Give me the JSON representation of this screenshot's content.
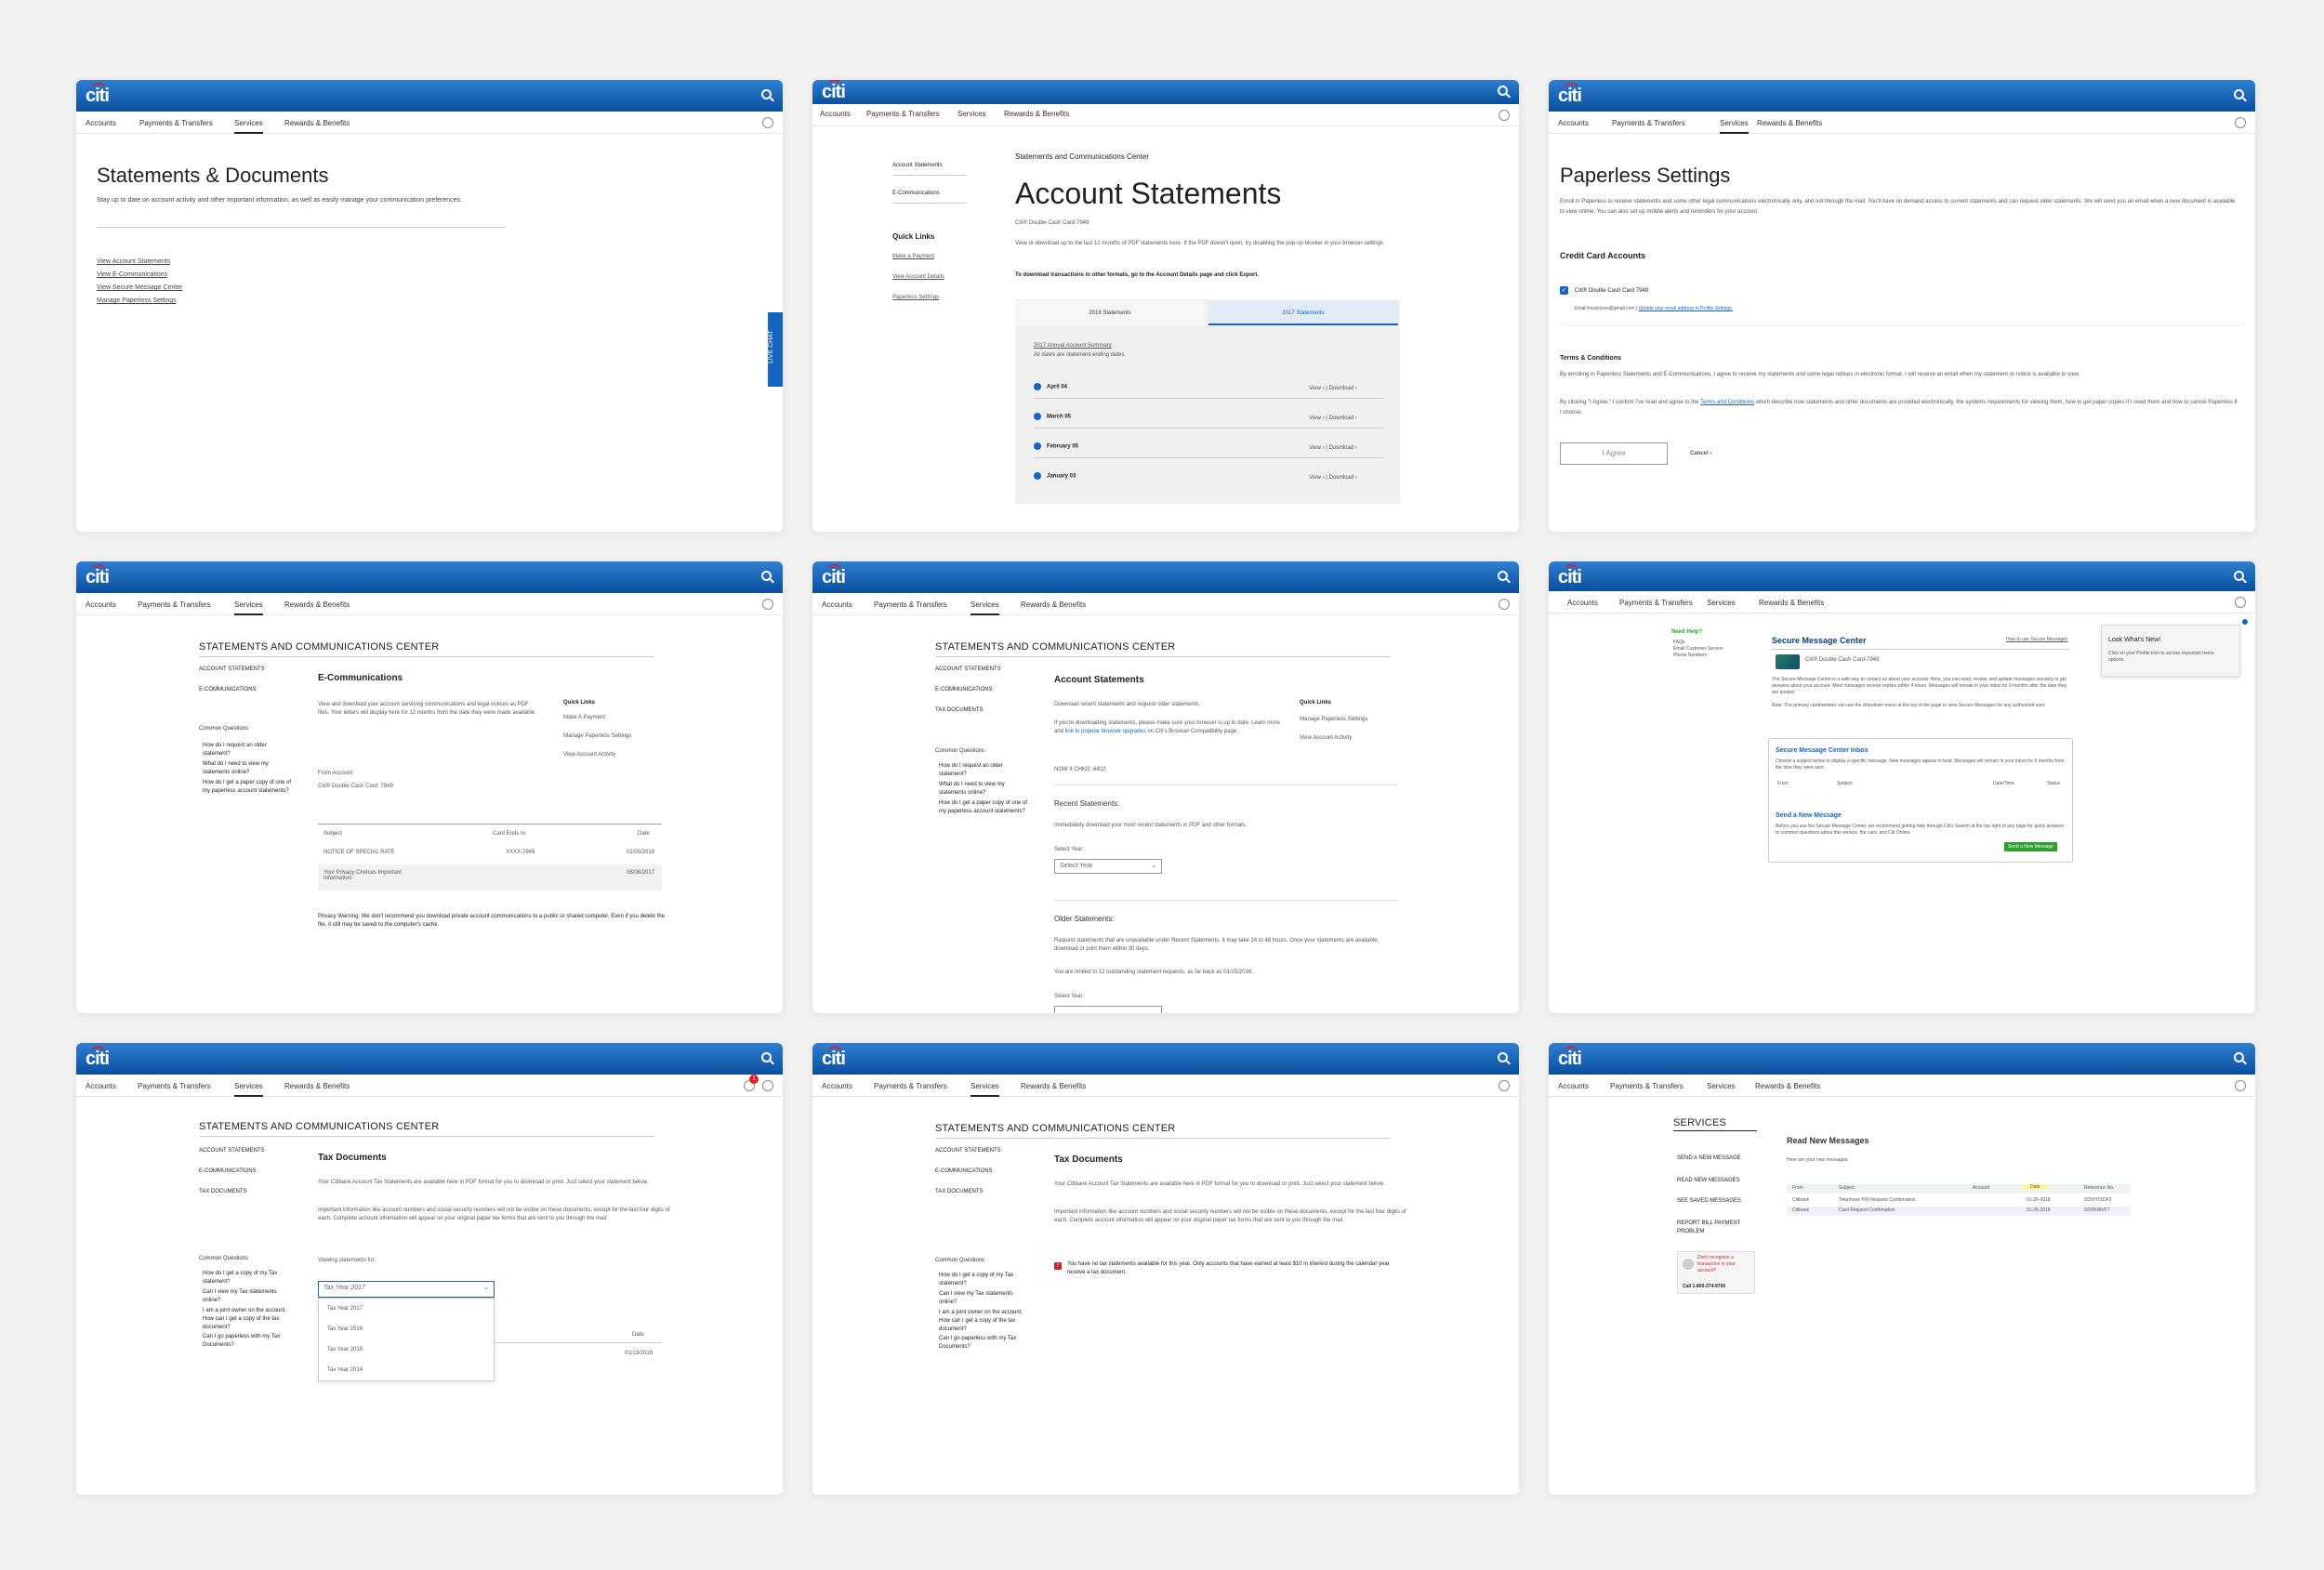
{
  "brand": {
    "logo": "citi"
  },
  "nav": {
    "accounts": "Accounts",
    "payments": "Payments & Transfers",
    "services": "Services",
    "rewards": "Rewards & Benefits"
  },
  "p1": {
    "title": "Statements & Documents",
    "subtitle": "Stay up to date on account activity and other important information, as well as easily manage your communication preferences.",
    "links": [
      "View Account Statements",
      "View E-Communications",
      "View Secure Message Center",
      "Manage Paperless Settings"
    ],
    "live_chat": "LIVE CHAT"
  },
  "p2": {
    "side": [
      "Account Statements",
      "E-Communications"
    ],
    "quick_title": "Quick Links",
    "quick": [
      "Make a Payment",
      "View Account Details",
      "Paperless Settings"
    ],
    "eyebrow": "Statements and Communications Center",
    "title": "Account Statements",
    "card": "Citi® Double Cash Card-7949",
    "desc": "View or download up to the last 12 months of PDF statements here. If the PDF doesn't open, try disabling the pop-up blocker in your browser settings.",
    "bold_note": "To download transactions in other formats, go to the Account Details page and click Export.",
    "tabs": [
      "2018 Statements",
      "2017 Statements"
    ],
    "summary_link": "2017 Annual Account Summary",
    "summary_note": "All dates are statement ending dates.",
    "rows": [
      "April 04",
      "March 05",
      "February 05",
      "January 03"
    ],
    "view": "View ›",
    "download": "Download ›"
  },
  "p3": {
    "title": "Paperless Settings",
    "desc": "Enroll in Paperless to receive statements and some other legal communications electronically only, and not through the mail. You'll have on demand access to current statements and can request older statements. We will send you an email when a new document is available to view online. You can also set up mobile alerts and reminders for your account.",
    "section": "Credit Card Accounts",
    "card": "Citi® Double Cash Card 7949",
    "email": "Email:hxxxxxxxx@gmail.com",
    "email_link": "Update your email address in Profile Settings.",
    "terms_title": "Terms & Conditions",
    "terms1": "By enrolling in Paperless Statements and E-Communications, I agree to receive my statements and some legal notices in electronic format. I will receive an email when my statement or notice is available to view.",
    "terms2a": "By clicking \"I Agree,\" I confirm I've read and agree to the",
    "terms_link": "Terms and Conditions",
    "terms2b": "which describe how statements and other documents are provided electronically, the systems requirements for viewing them, how to get paper copies if I need them and how to cancel Paperless if I choose.",
    "agree": "I Agree",
    "cancel": "Cancel ›"
  },
  "center": {
    "title": "STATEMENTS AND COMMUNICATIONS CENTER",
    "side": [
      "ACCOUNT STATEMENTS",
      "E-COMMUNICATIONS",
      "TAX DOCUMENTS"
    ],
    "cq": "Common Questions",
    "q_stmt": [
      "How do I request an older statement?",
      "What do I need to view my statements online?",
      "How do I get a paper copy of one of my paperless account statements?"
    ],
    "q_tax": [
      "How do I get a copy of my Tax statement?",
      "Can I view my Tax statements online?",
      "I am a joint owner on the account. How can I get a copy of the tax document?",
      "Can I go paperless with my Tax Documents?"
    ],
    "quick_title": "Quick Links"
  },
  "p4": {
    "heading": "E-Communications",
    "desc": "View and download your account servicing communications and legal notices as PDF files. Your letters will display here for 12 months from the date they were made available.",
    "quick": [
      "Make A Payment",
      "Manage Paperless Settings",
      "View Account Activity"
    ],
    "from_label": "From Account:",
    "from_value": "Citi® Double Cash Card: 7949",
    "cols": [
      "Subject",
      "Card Ends In",
      "Date"
    ],
    "row1": [
      "NOTICE OF SPECIAL RATE",
      "XXXX-7949",
      "01/05/2018"
    ],
    "row2": [
      "Your Privacy Choices Important Information",
      "",
      "08/08/2017"
    ],
    "privacy": "Privacy Warning: We don't recommend you download private account communications to a public or shared computer. Even if you delete the file, it still may be saved to the computer's cache."
  },
  "p5": {
    "heading": "Account Statements",
    "desc1": "Download recent statements and request older statements.",
    "desc2": "If you're downloading statements, please make sure your browser is up to date. Learn more and",
    "desc2_link": "link to popular browser upgrades",
    "desc2b": "on Citi's Browser Compatibility page.",
    "acct": "NOW II CHKG: 6422",
    "quick": [
      "Manage Paperless Settings",
      "View Account Activity"
    ],
    "recent": "Recent Statements:",
    "recent_desc": "Immediately download your most recent statements in PDF and other formats.",
    "select_label": "Select Year:",
    "select_ph": "Select Year",
    "older": "Older Statements:",
    "older_desc": "Request statements that are unavailable under Recent Statements. It may take 24 to 48 hours. Once your statements are available, download or print them within 30 days.",
    "limit": "You are limited to 12 outstanding statement requests, as far back as 01/25/2016.",
    "select_label2": "Select Year:"
  },
  "p6": {
    "need_help": "Need Help?",
    "help_links": [
      "FAQs",
      "Email Customer Service",
      "Phone Numbers"
    ],
    "title": "Secure Message Center",
    "howto": "How to use Secure Messages",
    "card": "Citi® Double Cash Card-7949",
    "desc": "The Secure Message Center is a safe way to contact us about your account. Here, you can send, review, and update messages securely to get answers about your account. Most messages receive replies within 4 hours. Messages will remain in your inbox for 6 months after the date they are posted.",
    "note": "Note: The primary cardmember can use the dropdown menu at the top of the page to view Secure Messages for any authorized user.",
    "inbox_title": "Secure Message Center Inbox",
    "inbox_desc": "Choose a subject below to display a specific message. New messages appear in bold. Messages will remain in your inbox for 6 months from the time they were sent.",
    "cols": [
      "From",
      "Subject",
      "Date/Time",
      "Status"
    ],
    "send_title": "Send a New Message",
    "send_desc": "Before you use the Secure Message Center, we recommend getting help through Citi's Search at the top right of any page for quick answers to common questions about this service, the card, and Citi Online.",
    "send_btn": "Send a New Message",
    "tip_title": "Look What's New!",
    "tip_desc": "Click on your Profile icon to access important menu options."
  },
  "p7": {
    "heading": "Tax Documents",
    "desc1": "Your Citibank Account Tax Statements are available here in PDF format for you to download or print. Just select your statement below.",
    "desc2": "Important information like account numbers and social security numbers will not be visible on these documents, except for the last four digits of each. Complete account information will appear on your original paper tax forms that are sent to you through the mail.",
    "viewing": "Viewing statements for:",
    "selected": "Tax Year 2017",
    "options": [
      "Tax Year 2017",
      "Tax Year 2016",
      "Tax Year 2015",
      "Tax Year 2014"
    ],
    "col_date": "Date",
    "row_date": "01/13/2018",
    "badge": "1"
  },
  "p8": {
    "heading": "Tax Documents",
    "desc1": "Your Citibank Account Tax Statements are available here in PDF format for you to download or print. Just select your statement below.",
    "desc2": "Important information like account numbers and social security numbers will not be visible on these documents, except for the last four digits of each. Complete account information will appear on your original paper tax forms that are sent to you through the mail.",
    "warning": "You have no tax statements available for this year. Only accounts that have earned at least $10 in interest during the calendar year receive a tax document."
  },
  "p9": {
    "title": "SERVICES",
    "side": [
      "SEND A NEW MESSAGE",
      "READ NEW MESSAGES",
      "SEE SAVED MESSAGES",
      "REPORT BILL PAYMENT PROBLEM"
    ],
    "promo": "Don't recognize a transaction in your account?",
    "promo_call": "Call 1-800-374-9700",
    "heading": "Read New Messages",
    "intro": "Here are your new messages:",
    "cols": [
      "From",
      "Subject",
      "Account",
      "Date",
      "Reference No."
    ],
    "rows": [
      [
        "Citibank",
        "Telephone PIN Request Confirmation",
        "",
        "01-26-2018",
        "SDVH7XDF3"
      ],
      [
        "Citibank",
        "Card Request Confirmation",
        "",
        "01-25-2018",
        "SDVKWVF7"
      ]
    ]
  }
}
